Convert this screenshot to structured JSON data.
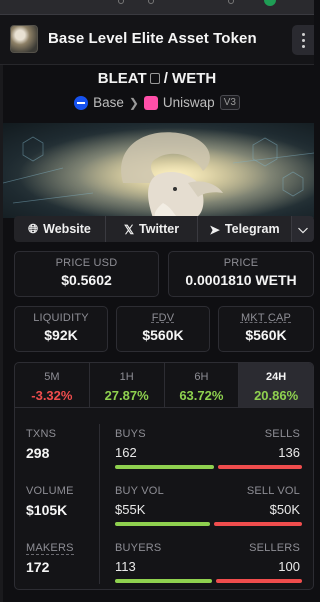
{
  "header": {
    "title": "Base Level Elite Asset Token"
  },
  "pair": {
    "base_symbol": "BLEAT",
    "separator": "/",
    "quote_symbol": "WETH"
  },
  "chain": {
    "network": "Base",
    "dex": "Uniswap",
    "version": "V3"
  },
  "links": {
    "website": "Website",
    "twitter": "Twitter",
    "telegram": "Telegram"
  },
  "prices": {
    "usd_label": "PRICE USD",
    "usd_value": "$0.5602",
    "native_label": "PRICE",
    "native_value": "0.0001810 WETH"
  },
  "metrics": {
    "liquidity_label": "LIQUIDITY",
    "liquidity_value": "$92K",
    "fdv_label": "FDV",
    "fdv_value": "$560K",
    "mktcap_label": "MKT CAP",
    "mktcap_value": "$560K"
  },
  "timeframes": [
    {
      "label": "5M",
      "change": "-3.32%",
      "status": "negative"
    },
    {
      "label": "1H",
      "change": "27.87%",
      "status": "positive"
    },
    {
      "label": "6H",
      "change": "63.72%",
      "status": "positive"
    },
    {
      "label": "24H",
      "change": "20.86%",
      "status": "positive",
      "active": true
    }
  ],
  "stats": {
    "txns_label": "TXNS",
    "txns_value": "298",
    "buys_label": "BUYS",
    "buys_value": "162",
    "sells_label": "SELLS",
    "sells_value": "136",
    "volume_label": "VOLUME",
    "volume_value": "$105K",
    "buy_vol_label": "BUY VOL",
    "buy_vol_value": "$55K",
    "sell_vol_label": "SELL VOL",
    "sell_vol_value": "$50K",
    "makers_label": "MAKERS",
    "makers_value": "172",
    "buyers_label": "BUYERS",
    "buyers_value": "113",
    "sellers_label": "SELLERS",
    "sellers_value": "100",
    "buys_ratio": 0.54,
    "buy_vol_ratio": 0.52,
    "buyers_ratio": 0.53
  },
  "colors": {
    "positive": "#8fd14f",
    "negative": "#f04d4d",
    "background": "#0f0f12",
    "card": "#141417"
  }
}
